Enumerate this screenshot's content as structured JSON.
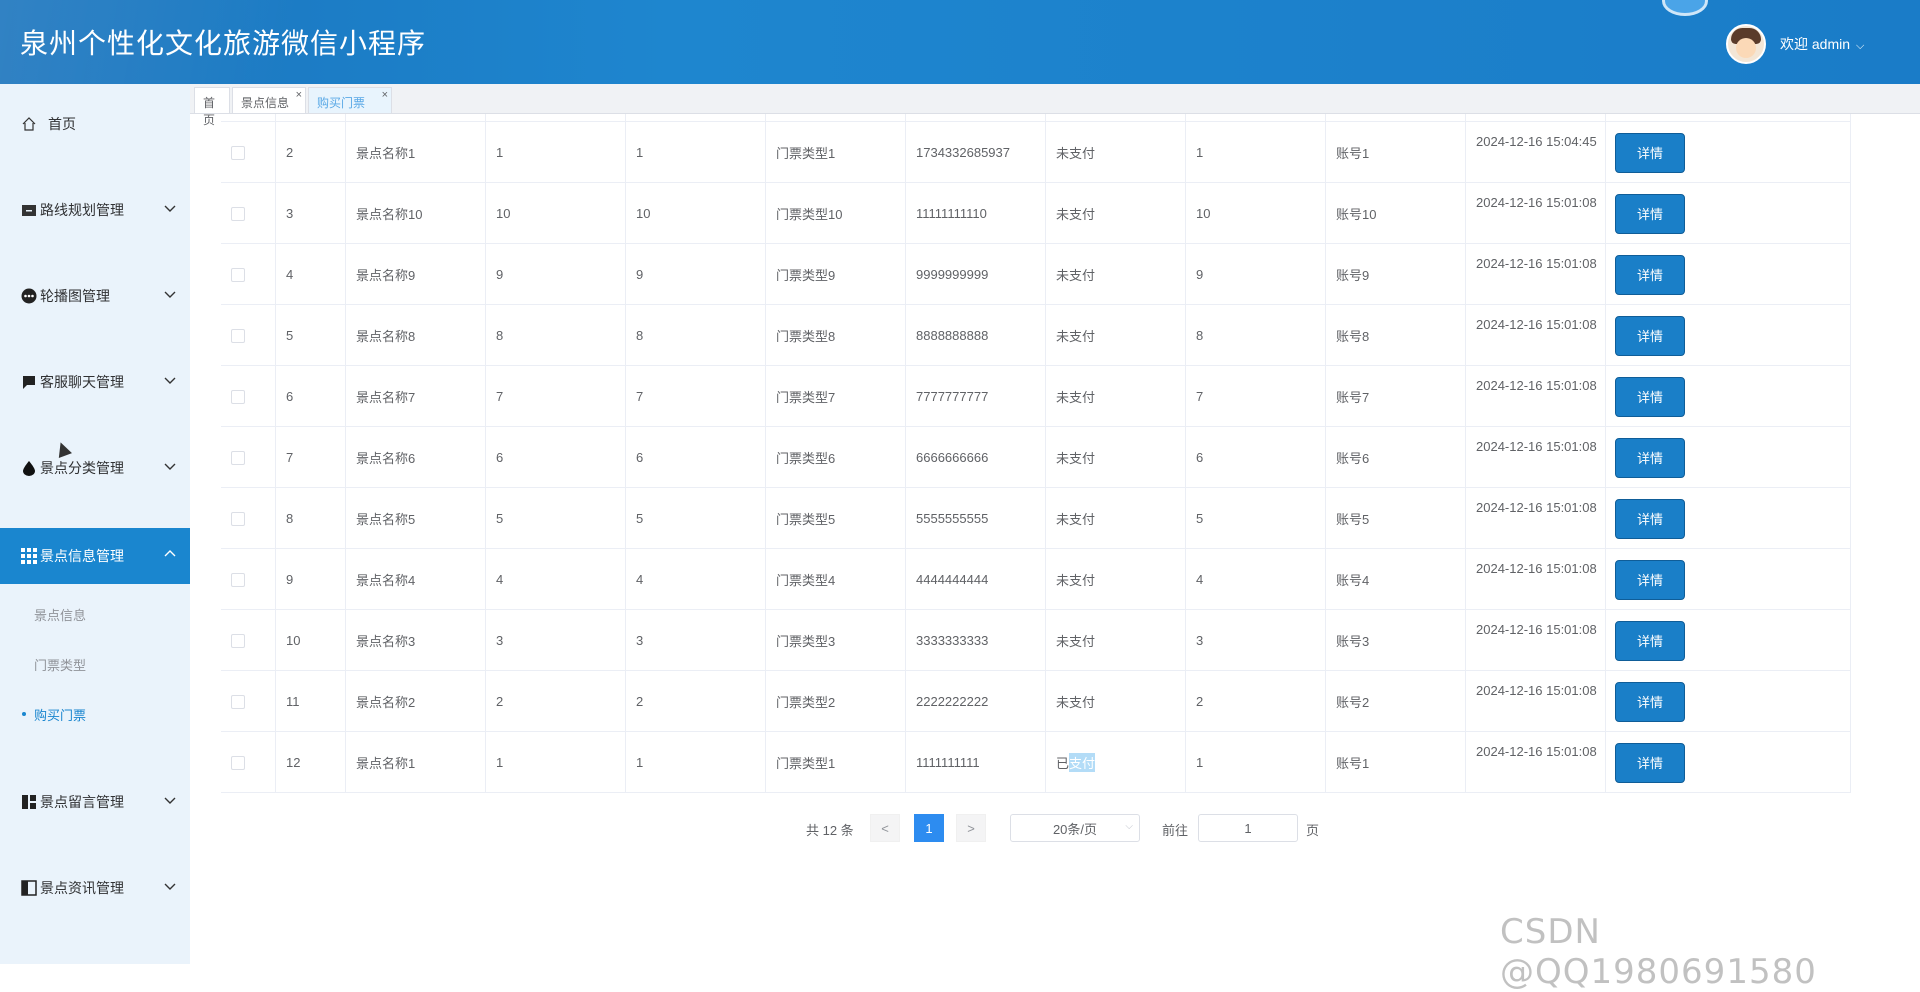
{
  "header": {
    "title": "泉州个性化文化旅游微信小程序",
    "welcome": "欢迎 admin",
    "caret": "⌵"
  },
  "sidebar": {
    "items": [
      {
        "label": "首页",
        "icon": "home-icon"
      },
      {
        "label": "路线规划管理",
        "icon": "folder-icon"
      },
      {
        "label": "轮播图管理",
        "icon": "dots-icon"
      },
      {
        "label": "客服聊天管理",
        "icon": "chat-icon"
      },
      {
        "label": "景点分类管理",
        "icon": "drop-icon"
      },
      {
        "label": "景点信息管理",
        "icon": "grid-icon"
      },
      {
        "label": "景点留言管理",
        "icon": "layout-icon"
      },
      {
        "label": "景点资讯管理",
        "icon": "panel-icon"
      }
    ],
    "submenu": [
      {
        "label": "景点信息"
      },
      {
        "label": "门票类型"
      },
      {
        "label": "购买门票"
      }
    ]
  },
  "tabs": [
    {
      "label": "首页"
    },
    {
      "label": "景点信息",
      "close": "×"
    },
    {
      "label": "购买门票",
      "close": "×"
    }
  ],
  "table": {
    "button_label": "详情",
    "rows": [
      {
        "id": "2",
        "name": "景点名称1",
        "c3": "1",
        "c4": "1",
        "type": "门票类型1",
        "phone": "1734332685937",
        "status": "未支付",
        "c8": "1",
        "account": "账号1",
        "time": "2024-12-16 15:04:45"
      },
      {
        "id": "3",
        "name": "景点名称10",
        "c3": "10",
        "c4": "10",
        "type": "门票类型10",
        "phone": "11111111110",
        "status": "未支付",
        "c8": "10",
        "account": "账号10",
        "time": "2024-12-16 15:01:08"
      },
      {
        "id": "4",
        "name": "景点名称9",
        "c3": "9",
        "c4": "9",
        "type": "门票类型9",
        "phone": "9999999999",
        "status": "未支付",
        "c8": "9",
        "account": "账号9",
        "time": "2024-12-16 15:01:08"
      },
      {
        "id": "5",
        "name": "景点名称8",
        "c3": "8",
        "c4": "8",
        "type": "门票类型8",
        "phone": "8888888888",
        "status": "未支付",
        "c8": "8",
        "account": "账号8",
        "time": "2024-12-16 15:01:08"
      },
      {
        "id": "6",
        "name": "景点名称7",
        "c3": "7",
        "c4": "7",
        "type": "门票类型7",
        "phone": "7777777777",
        "status": "未支付",
        "c8": "7",
        "account": "账号7",
        "time": "2024-12-16 15:01:08"
      },
      {
        "id": "7",
        "name": "景点名称6",
        "c3": "6",
        "c4": "6",
        "type": "门票类型6",
        "phone": "6666666666",
        "status": "未支付",
        "c8": "6",
        "account": "账号6",
        "time": "2024-12-16 15:01:08"
      },
      {
        "id": "8",
        "name": "景点名称5",
        "c3": "5",
        "c4": "5",
        "type": "门票类型5",
        "phone": "5555555555",
        "status": "未支付",
        "c8": "5",
        "account": "账号5",
        "time": "2024-12-16 15:01:08"
      },
      {
        "id": "9",
        "name": "景点名称4",
        "c3": "4",
        "c4": "4",
        "type": "门票类型4",
        "phone": "4444444444",
        "status": "未支付",
        "c8": "4",
        "account": "账号4",
        "time": "2024-12-16 15:01:08"
      },
      {
        "id": "10",
        "name": "景点名称3",
        "c3": "3",
        "c4": "3",
        "type": "门票类型3",
        "phone": "3333333333",
        "status": "未支付",
        "c8": "3",
        "account": "账号3",
        "time": "2024-12-16 15:01:08"
      },
      {
        "id": "11",
        "name": "景点名称2",
        "c3": "2",
        "c4": "2",
        "type": "门票类型2",
        "phone": "2222222222",
        "status": "未支付",
        "c8": "2",
        "account": "账号2",
        "time": "2024-12-16 15:01:08"
      },
      {
        "id": "12",
        "name": "景点名称1",
        "c3": "1",
        "c4": "1",
        "type": "门票类型1",
        "phone": "1111111111",
        "status_a": "已",
        "status_b": "支付",
        "c8": "1",
        "account": "账号1",
        "time": "2024-12-16 15:01:08"
      }
    ]
  },
  "pagination": {
    "total": "共 12 条",
    "prev": "<",
    "current": "1",
    "next": ">",
    "page_size": "20条/页",
    "goto": "前往",
    "goto_value": "1",
    "page_unit": "页"
  },
  "watermark": "CSDN @QQ1980691580",
  "colors": {
    "header": "#1a80c9",
    "accent": "#1a86cf",
    "sidebar_bg": "#eaf3fb"
  }
}
